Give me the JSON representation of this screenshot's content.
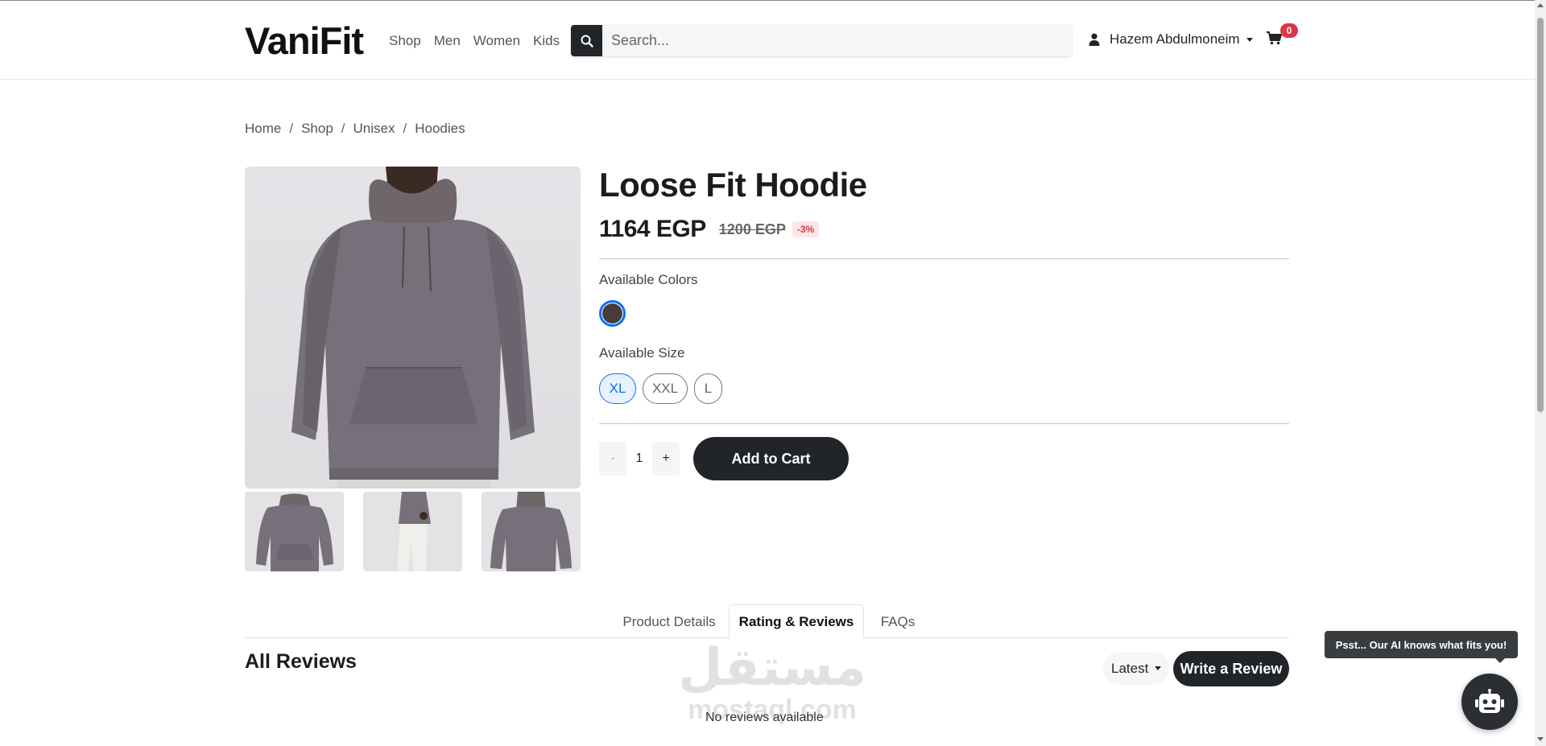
{
  "header": {
    "logo": "VaniFit",
    "nav": [
      "Shop",
      "Men",
      "Women",
      "Kids"
    ],
    "search_placeholder": "Search...",
    "user_name": "Hazem Abdulmoneim",
    "cart_count": "0"
  },
  "breadcrumb": [
    "Home",
    "Shop",
    "Unisex",
    "Hoodies"
  ],
  "product": {
    "title": "Loose Fit Hoodie",
    "price": "1164 EGP",
    "old_price": "1200 EGP",
    "discount": "-3%",
    "colors_label": "Available Colors",
    "colors": [
      "#463c3b"
    ],
    "size_label": "Available Size",
    "sizes": [
      "XL",
      "XXL",
      "L"
    ],
    "selected_size": "XL",
    "qty_minus": "-",
    "quantity": "1",
    "qty_plus": "+",
    "add_to_cart": "Add to Cart"
  },
  "tabs": [
    "Product Details",
    "Rating & Reviews",
    "FAQs"
  ],
  "active_tab": "Rating & Reviews",
  "reviews": {
    "title": "All Reviews",
    "sort": "Latest",
    "write": "Write a Review",
    "empty": "No reviews available"
  },
  "watermark": {
    "arabic": "مستقل",
    "latin": "mostaql.com"
  },
  "ai": {
    "tooltip": "Psst... Our AI knows what fits you!"
  },
  "colors": {
    "accent": "#0d6efd",
    "dark": "#212529",
    "danger": "#dc3545"
  }
}
